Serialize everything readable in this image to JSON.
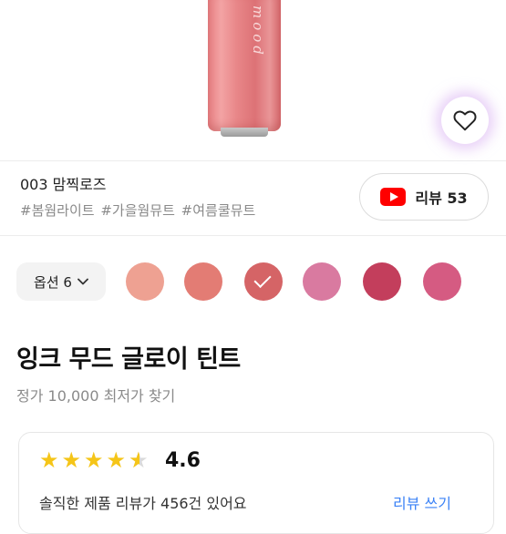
{
  "product_image": {
    "tube_text": "mood"
  },
  "product": {
    "shade_name": "003 맘찍로즈",
    "hashtags": "#봄웜라이트 #가을웜뮤트 #여름쿨뮤트",
    "title": "잉크 무드 글로이 틴트",
    "price_line": "정가 10,000 최저가 찾기"
  },
  "review_button": {
    "label": "리뷰 53",
    "icon": "youtube-icon"
  },
  "wishlist": {
    "icon": "heart-icon"
  },
  "options": {
    "button_label": "옵션 6",
    "swatches": [
      {
        "color": "#eea192",
        "selected": false
      },
      {
        "color": "#e37c74",
        "selected": false
      },
      {
        "color": "#d56466",
        "selected": true
      },
      {
        "color": "#d97aa0",
        "selected": false
      },
      {
        "color": "#c33e5c",
        "selected": false
      },
      {
        "color": "#d55b82",
        "selected": false
      }
    ]
  },
  "review_summary": {
    "rating": "4.6",
    "rating_value": 4.6,
    "summary_text": "솔직한 제품 리뷰가 456건 있어요",
    "write_label": "리뷰 쓰기"
  }
}
